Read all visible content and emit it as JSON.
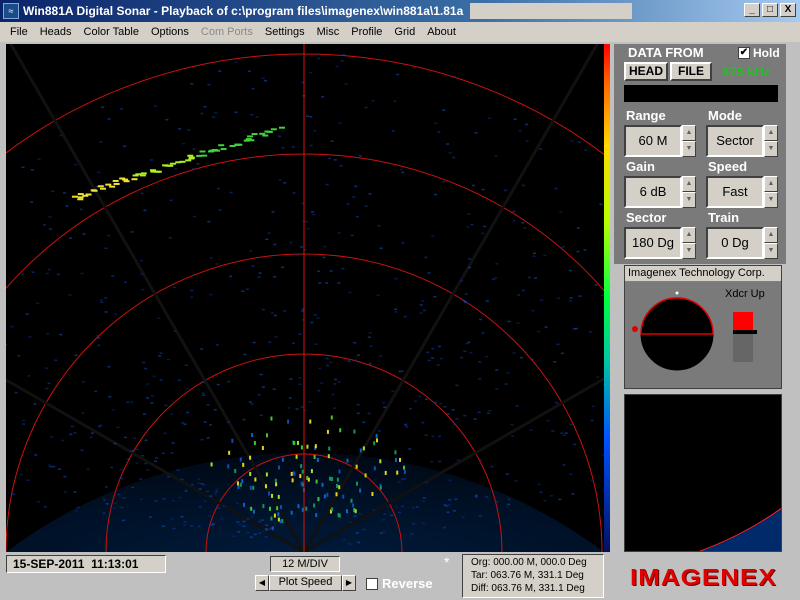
{
  "window": {
    "title": "Win881A Digital Sonar - Playback of c:\\program files\\imagenex\\win881a\\1.81a",
    "icon": "app-icon",
    "buttons": [
      "_",
      "□",
      "X"
    ]
  },
  "menu": {
    "items": [
      {
        "label": "File",
        "disabled": false
      },
      {
        "label": "Heads",
        "disabled": false
      },
      {
        "label": "Color Table",
        "disabled": false
      },
      {
        "label": "Options",
        "disabled": false
      },
      {
        "label": "Com Ports",
        "disabled": true
      },
      {
        "label": "Settings",
        "disabled": false
      },
      {
        "label": "Misc",
        "disabled": false
      },
      {
        "label": "Profile",
        "disabled": false
      },
      {
        "label": "Grid",
        "disabled": false
      },
      {
        "label": "About",
        "disabled": false
      }
    ]
  },
  "panel": {
    "data_from_label": "DATA FROM",
    "hold_label": "Hold",
    "hold_checked": true,
    "head_button": "HEAD",
    "file_button": "FILE",
    "frequency": "675 kHz",
    "controls": {
      "range": {
        "label": "Range",
        "value": "60 M"
      },
      "mode": {
        "label": "Mode",
        "value": "Sector"
      },
      "gain": {
        "label": "Gain",
        "value": "6 dB"
      },
      "speed": {
        "label": "Speed",
        "value": "Fast"
      },
      "sector": {
        "label": "Sector",
        "value": "180 Dg"
      },
      "train": {
        "label": "Train",
        "value": "0 Dg"
      }
    },
    "company": "Imagenex Technology Corp.",
    "xdcr_label": "Xdcr Up",
    "logo": "IMAGENEX"
  },
  "bottom": {
    "date": "15-SEP-2011",
    "time": "11:13:01",
    "scale": "12 M/DIV",
    "marker": "*",
    "plot_speed": "Plot Speed",
    "reverse_label": "Reverse",
    "reverse_checked": false,
    "readout": {
      "org": "Org: 000.00 M, 000.0 Deg",
      "tar": "Tar: 063.76 M, 331.1 Deg",
      "dif": "Diff: 063.76 M, 331.1 Deg"
    }
  },
  "colors": {
    "grid": "#cc1111",
    "accent_green": "#22c022",
    "logo_red": "#e00000"
  }
}
